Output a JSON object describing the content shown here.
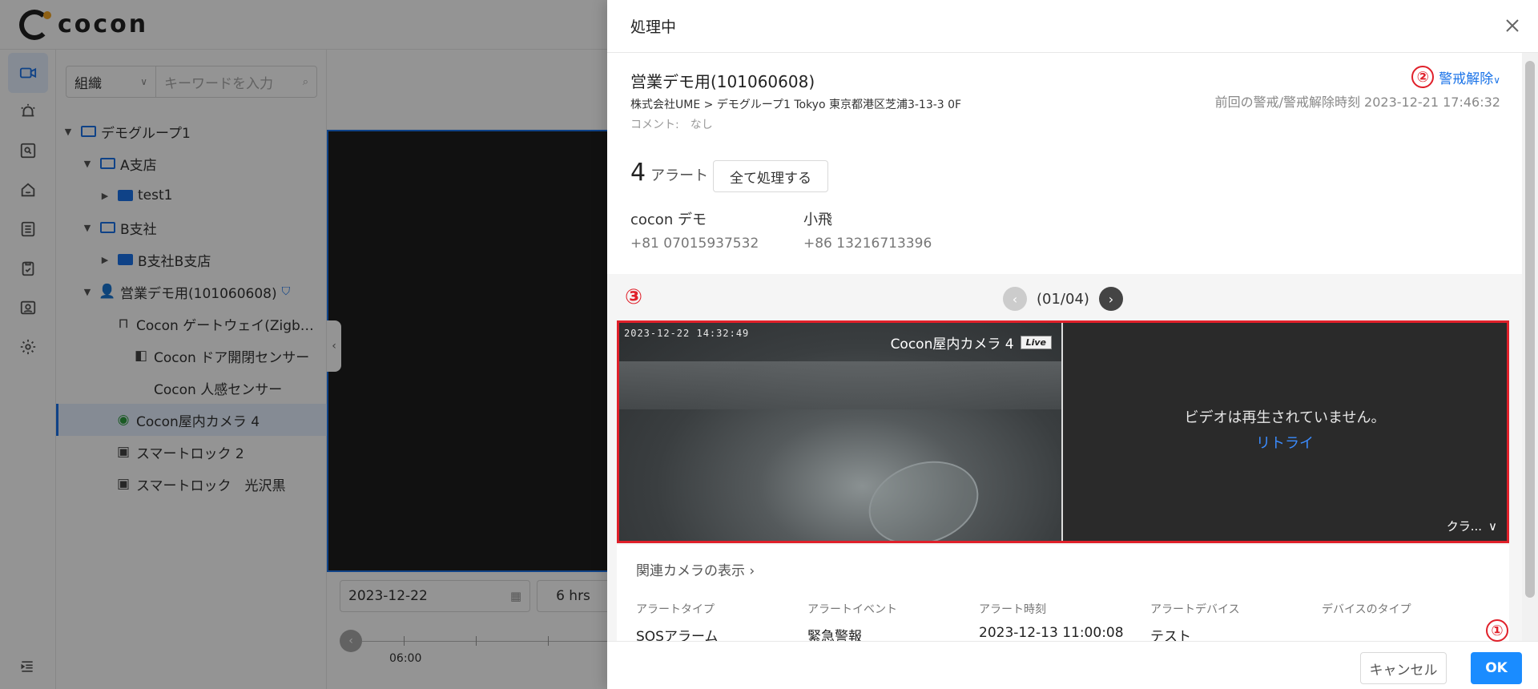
{
  "app": {
    "logo_text": "cocon",
    "filter": {
      "select_value": "組織",
      "search_placeholder": "キーワードを入力"
    },
    "tree": [
      {
        "label": "デモグループ1"
      },
      {
        "label": "A支店"
      },
      {
        "label": "test1"
      },
      {
        "label": "B支社"
      },
      {
        "label": "B支社B支店"
      },
      {
        "label": "営業デモ用(101060608)"
      },
      {
        "label": "Cocon ゲートウェイ(Zigb…"
      },
      {
        "label": "Cocon ドア開閉センサー"
      },
      {
        "label": "Cocon 人感センサー"
      },
      {
        "label": "Cocon屋内カメラ 4"
      },
      {
        "label": "スマートロック 2"
      },
      {
        "label": "スマートロック　光沢黒"
      }
    ],
    "date_value": "2023-12-22",
    "duration_value": "6 hrs",
    "timeline_label": "06:00"
  },
  "drawer": {
    "title": "処理中",
    "site": {
      "name": "営業デモ用(101060608)",
      "path": "株式会社UME > デモグループ1 Tokyo 東京都港区芝浦3-13-3 0F",
      "comment": "コメント:　なし"
    },
    "disarm_label": "警戒解除",
    "last_arm": "前回の警戒/警戒解除時刻 2023-12-21 17:46:32",
    "alert_count": "4",
    "alert_word": "アラート",
    "process_all_label": "全て処理する",
    "contacts": [
      {
        "name": "cocon デモ",
        "phone": "+81 07015937532"
      },
      {
        "name": "小飛",
        "phone": "+86 13216713396"
      }
    ],
    "pager_text": "(01/04)",
    "camera": {
      "timestamp": "2023-12-22 14:32:49",
      "name": "Cocon屋内カメラ 4",
      "live_tag": "Live",
      "no_play_text": "ビデオは再生されていません。",
      "retry_label": "リトライ",
      "quality_label": "クラ..."
    },
    "related_camera_label": "関連カメラの表示",
    "info": {
      "headers": [
        "アラートタイプ",
        "アラートイベント",
        "アラート時刻",
        "アラートデバイス",
        "デバイスのタイプ"
      ],
      "values": [
        "SOSアラーム",
        "緊急警報",
        "2023-12-13 11:00:08",
        "テスト",
        ""
      ]
    },
    "cancel_label": "キャンセル",
    "ok_label": "OK",
    "annotations": {
      "one": "①",
      "two": "②",
      "three": "③"
    }
  },
  "colors": {
    "accent": "#1a8cff",
    "annotation_red": "#e0202a"
  }
}
